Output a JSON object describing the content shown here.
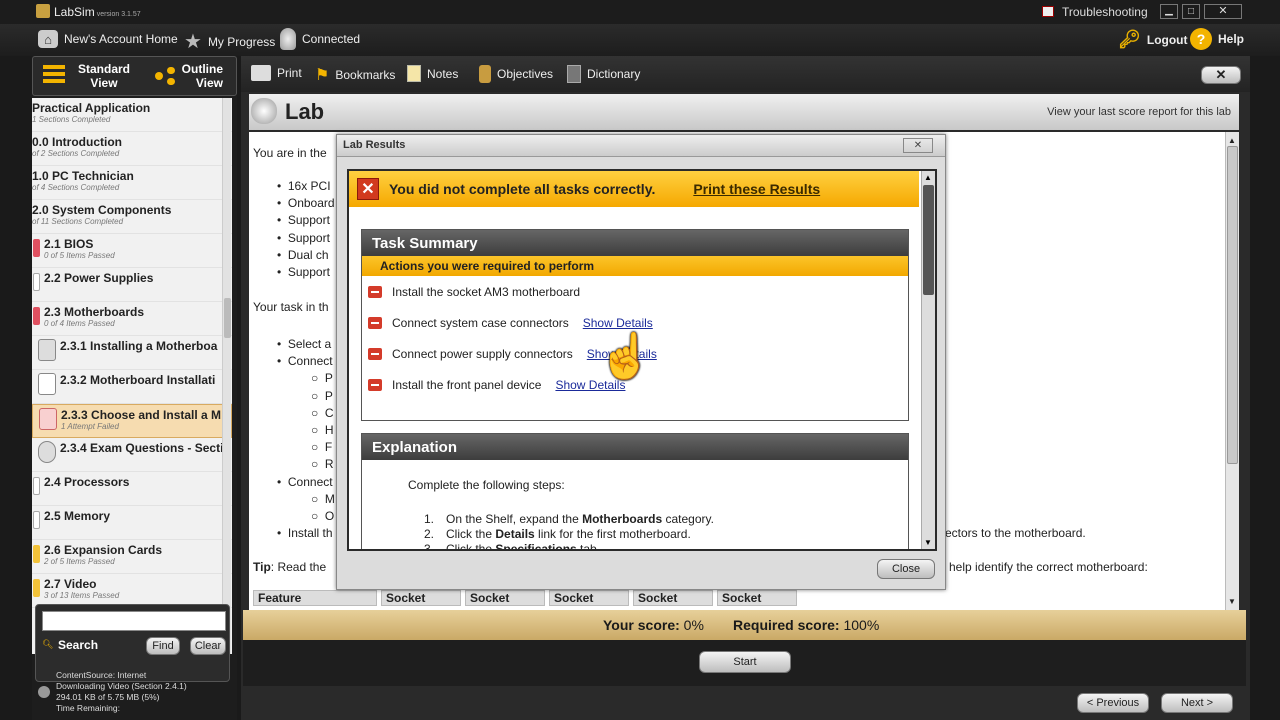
{
  "titlebar": {
    "app_name": "LabSim",
    "version": "version 3.1.57",
    "troubleshooting": "Troubleshooting"
  },
  "topbar": {
    "home": "New's Account Home",
    "progress": "My Progress",
    "connected": "Connected",
    "logout": "Logout",
    "help": "Help"
  },
  "sidebar": {
    "tabs": {
      "standard": "Standard View",
      "outline": "Outline View"
    },
    "items": [
      {
        "title": "Practical Application",
        "sub": "1 Sections Completed"
      },
      {
        "title": "0.0 Introduction",
        "sub": "of 2 Sections Completed"
      },
      {
        "title": "1.0 PC Technician",
        "sub": "of 4 Sections Completed"
      },
      {
        "title": "2.0 System Components",
        "sub": "of 11 Sections Completed"
      },
      {
        "title": "2.1 BIOS",
        "sub": "0 of 5 Items Passed"
      },
      {
        "title": "2.2 Power Supplies",
        "sub": ""
      },
      {
        "title": "2.3 Motherboards",
        "sub": "0 of 4 Items Passed"
      },
      {
        "title": "2.3.1 Installing a Motherboa",
        "sub": ""
      },
      {
        "title": "2.3.2 Motherboard Installati",
        "sub": ""
      },
      {
        "title": "2.3.3 Choose and Install a M",
        "sub": "1 Attempt Failed"
      },
      {
        "title": "2.3.4 Exam Questions - Secti",
        "sub": ""
      },
      {
        "title": "2.4 Processors",
        "sub": ""
      },
      {
        "title": "2.5 Memory",
        "sub": ""
      },
      {
        "title": "2.6 Expansion Cards",
        "sub": "2 of 5 Items Passed"
      },
      {
        "title": "2.7 Video",
        "sub": "3 of 13 Items Passed"
      }
    ],
    "search_label": "Search",
    "find": "Find",
    "clear": "Clear",
    "status": [
      "ContentSource: Internet",
      "Downloading Video (Section 2.4.1)",
      "294.01 KB of 5.75 MB (5%)",
      "Time Remaining:"
    ]
  },
  "toolbar": {
    "print": "Print",
    "bookmarks": "Bookmarks",
    "notes": "Notes",
    "objectives": "Objectives",
    "dictionary": "Dictionary"
  },
  "lab": {
    "title": "Lab",
    "score_link": "View your last score report for this lab",
    "intro": "You are in the",
    "bullets": [
      "16x PCI",
      "Onboard",
      "Support",
      "Support",
      "Dual ch",
      "Support"
    ],
    "task_intro": "Your task in th",
    "steps": [
      "Select a",
      "Connect",
      "Connect",
      "Install th"
    ],
    "sub_steps": [
      "P",
      "P",
      "C",
      "H",
      "F",
      "R"
    ],
    "sub_steps2": [
      "M",
      "O"
    ],
    "right_tail": "ectors to the motherboard.",
    "tip_label": "Tip",
    "tip_text": ": Read the",
    "tip_tail": "help identify the correct motherboard:",
    "table_headers": [
      "Feature",
      "Socket",
      "Socket",
      "Socket",
      "Socket",
      "Socket"
    ]
  },
  "score": {
    "your_label": "Your score:",
    "your_value": "0%",
    "required_label": "Required score:",
    "required_value": "100%"
  },
  "start_label": "Start",
  "nav": {
    "previous": "< Previous",
    "next": "Next >"
  },
  "modal": {
    "title": "Lab Results",
    "banner": "You did not complete all tasks correctly.",
    "print_link": "Print these Results",
    "task_summary": "Task Summary",
    "actions_header": "Actions you were required to perform",
    "tasks": [
      {
        "label": "Install the socket AM3 motherboard",
        "link": ""
      },
      {
        "label": "Connect system case connectors",
        "link": "Show Details"
      },
      {
        "label": "Connect power supply connectors",
        "link": "Show Details"
      },
      {
        "label": "Install the front panel device",
        "link": "Show Details"
      }
    ],
    "explanation": "Explanation",
    "explain_intro": "Complete the following steps:",
    "steps": [
      {
        "num": "1.",
        "pre": "On the Shelf, expand the ",
        "bold": "Motherboards",
        "post": " category."
      },
      {
        "num": "2.",
        "pre": "Click the ",
        "bold": "Details",
        "post": " link for the first motherboard."
      },
      {
        "num": "3.",
        "pre": "Click the ",
        "bold": "Specifications",
        "post": " tab."
      }
    ],
    "close": "Close"
  }
}
